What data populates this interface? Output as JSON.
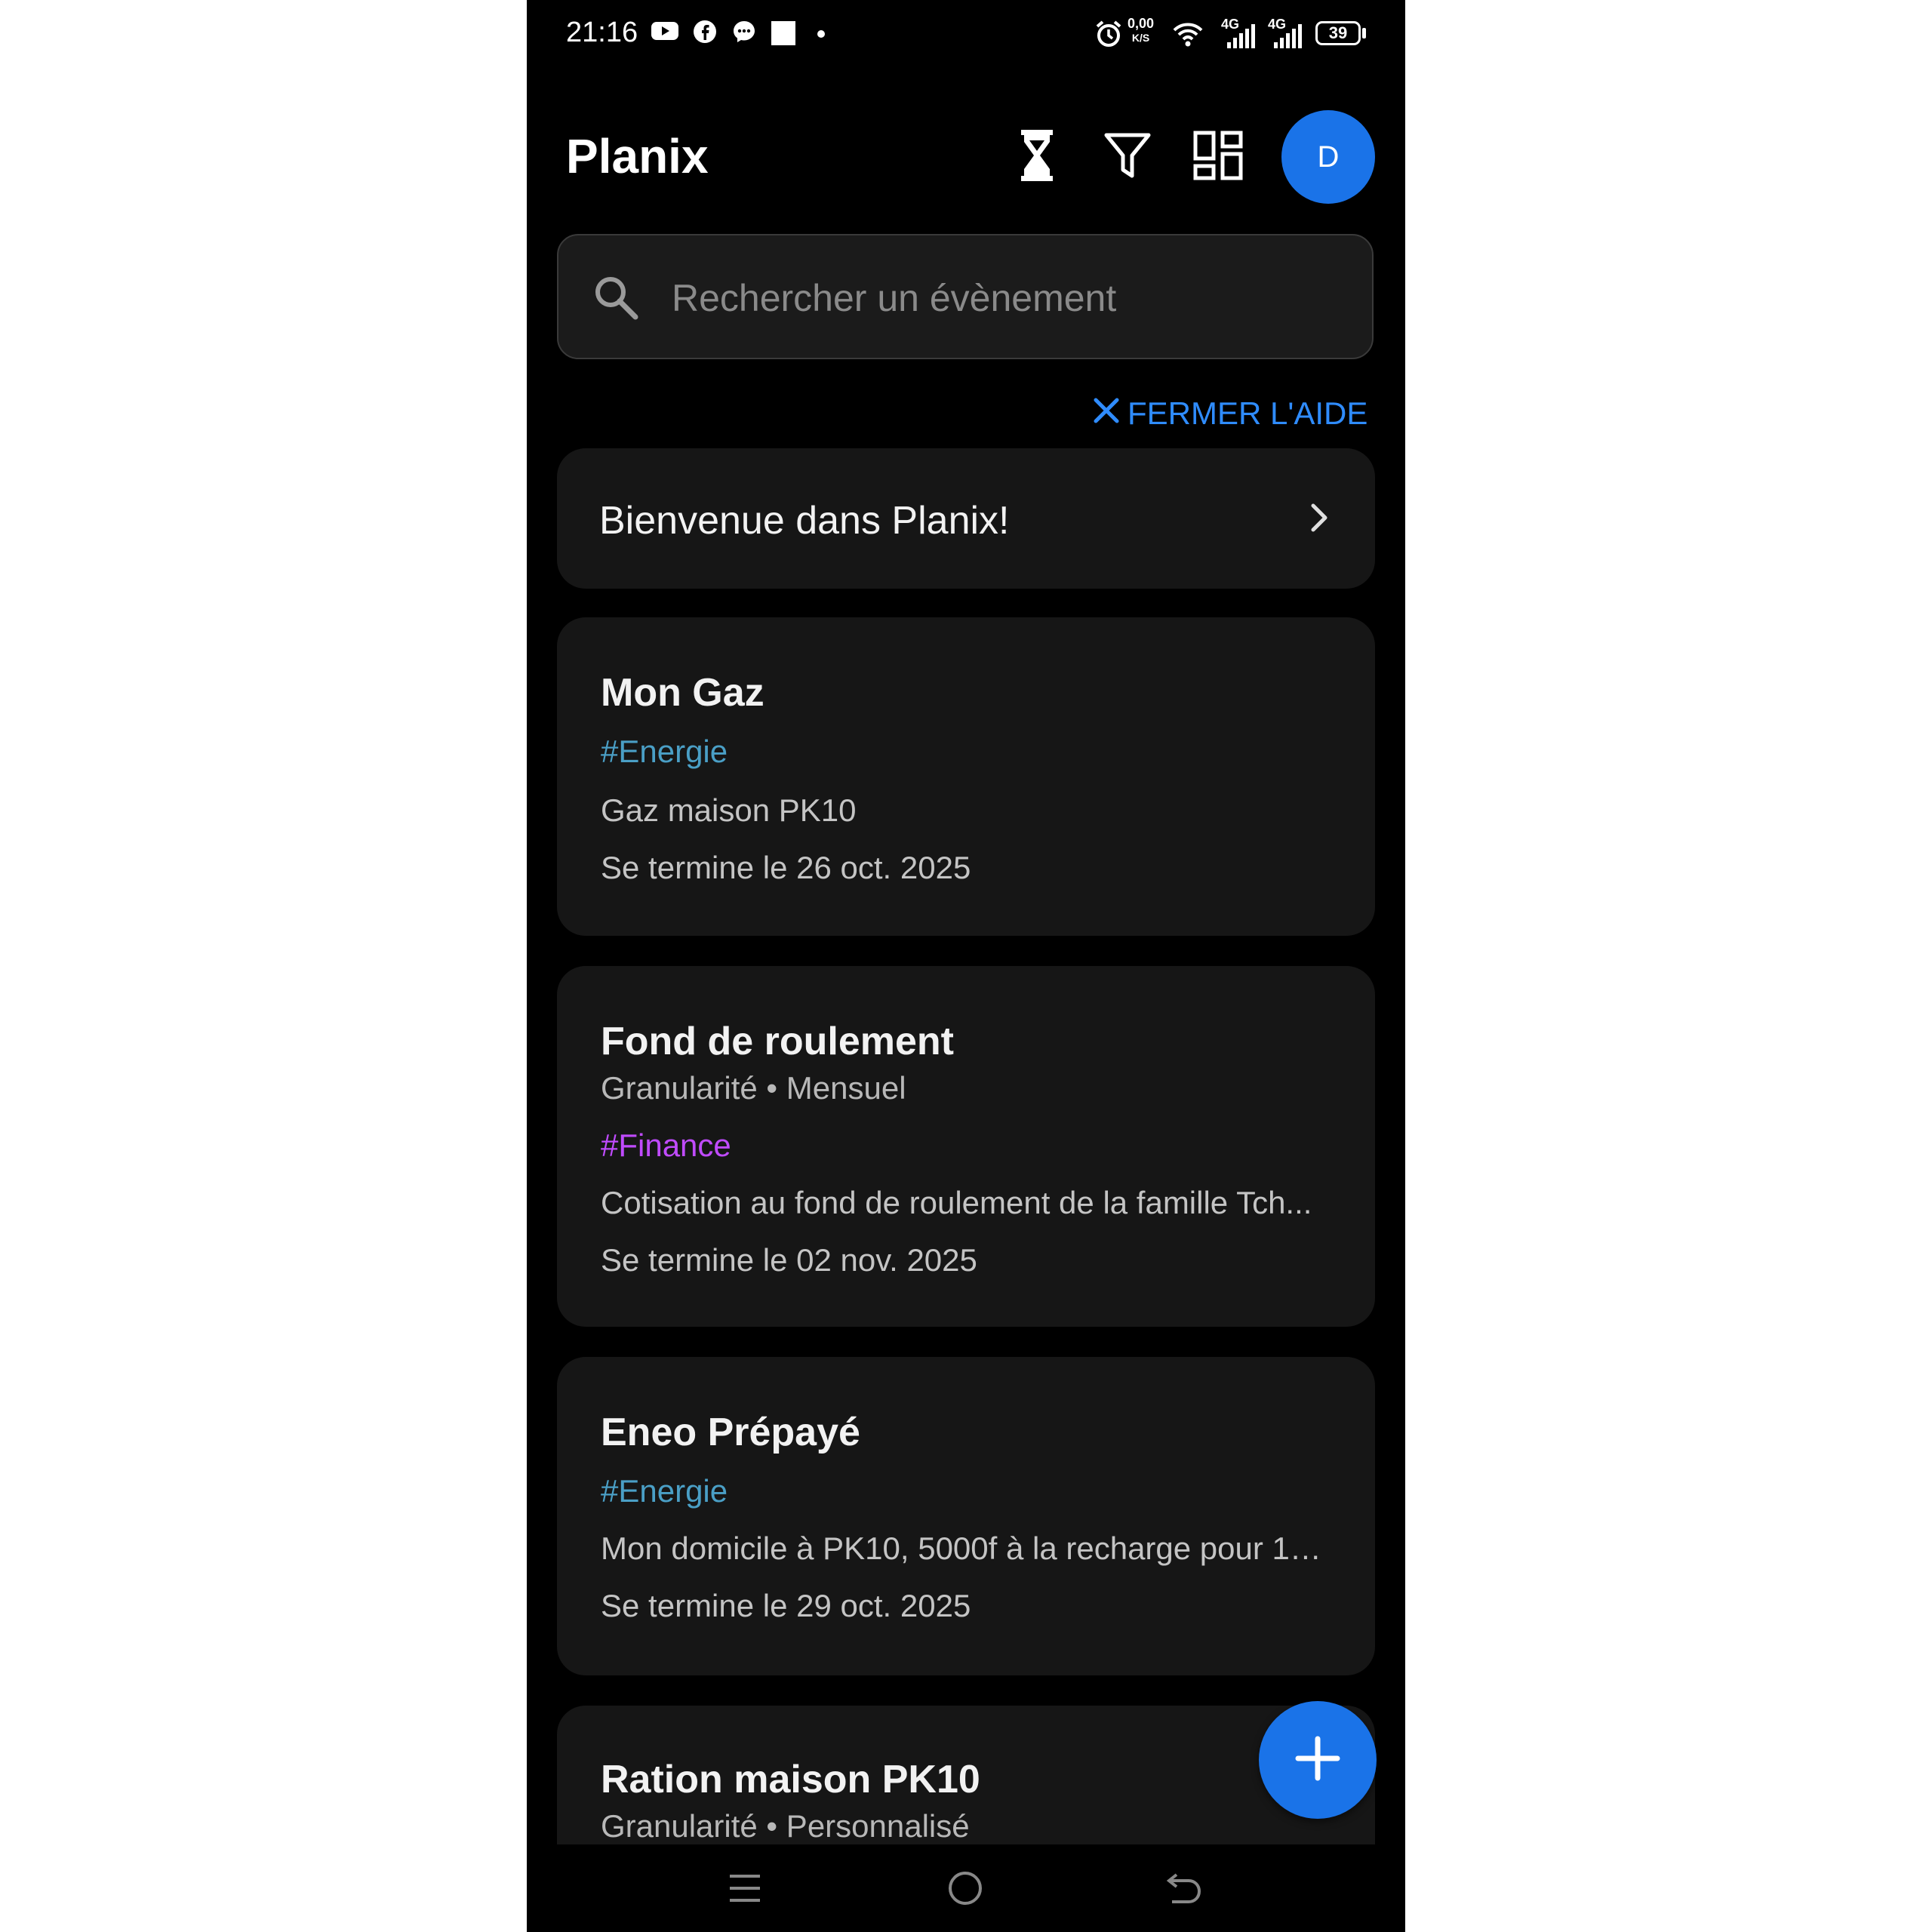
{
  "status_bar": {
    "time": "21:16",
    "net_speed_value": "0,00",
    "net_speed_unit": "K/S",
    "network_1": "4G",
    "network_2": "4G",
    "battery": "39",
    "icons": [
      "youtube-icon",
      "facebook-icon",
      "messenger-icon",
      "square-icon",
      "dot-icon",
      "alarm-icon",
      "wifi-icon",
      "signal-icon",
      "battery-icon"
    ]
  },
  "app_bar": {
    "title": "Planix",
    "actions": [
      "hourglass-icon",
      "filter-icon",
      "dashboard-icon"
    ],
    "avatar_initial": "D",
    "accent": "#1a73e8"
  },
  "search": {
    "placeholder": "Rechercher un évènement",
    "value": ""
  },
  "help": {
    "close_label": "FERMER L'AIDE",
    "welcome_text": "Bienvenue dans Planix!"
  },
  "events": [
    {
      "title": "Mon Gaz",
      "tag": "#Energie",
      "tag_color": "#4a9fc6",
      "description": "Gaz maison PK10",
      "end_date": "Se termine le 26 oct. 2025"
    },
    {
      "title": "Fond de roulement",
      "granularity": "Granularité • Mensuel",
      "tag": "#Finance",
      "tag_color": "#c04bff",
      "description": "Cotisation au fond de roulement de la famille Tch...",
      "end_date": "Se termine le 02 nov. 2025"
    },
    {
      "title": "Eneo Prépayé",
      "tag": "#Energie",
      "tag_color": "#4a9fc6",
      "description": "Mon domicile à PK10, 5000f à la recharge pour 10...",
      "end_date": "Se termine le 29 oct. 2025"
    },
    {
      "title": "Ration maison PK10",
      "granularity": "Granularité • Personnalisé"
    }
  ],
  "fab": {
    "icon": "plus-icon"
  },
  "nav_bar": {
    "icons": [
      "menu-icon",
      "home-icon",
      "back-icon"
    ]
  }
}
